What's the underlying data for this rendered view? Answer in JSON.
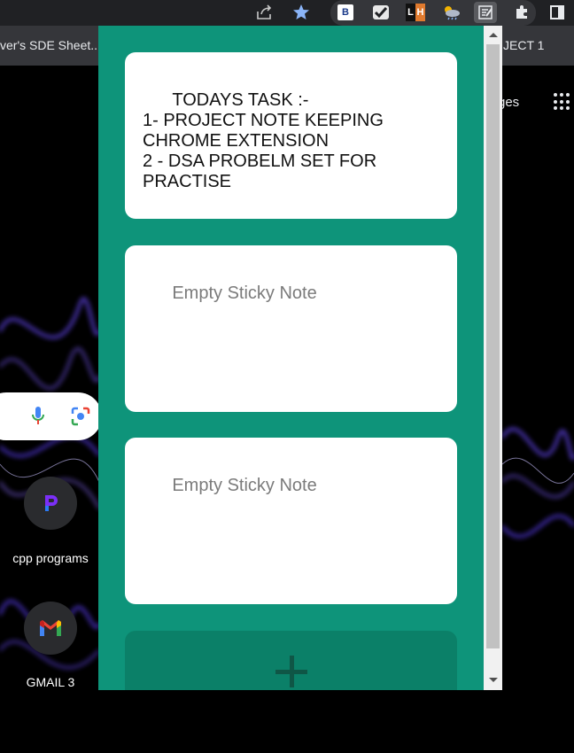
{
  "bookmarks": {
    "left": "ver's SDE Sheet..",
    "right": "JECT 1"
  },
  "ntp": {
    "pages_text": "ges",
    "shortcuts": [
      {
        "label": "cpp programs",
        "icon": "pcloud-icon"
      },
      {
        "label": "GMAIL 3",
        "icon": "gmail-icon"
      }
    ]
  },
  "notes": [
    {
      "text": "TODAYS TASK :-\n1- PROJECT NOTE KEEPING CHROME EXTENSION\n2 - DSA PROBELM SET FOR PRACTISE",
      "placeholder": ""
    },
    {
      "text": "",
      "placeholder": "Empty Sticky Note"
    },
    {
      "text": "",
      "placeholder": "Empty Sticky Note"
    }
  ],
  "extensions": {
    "b": "B",
    "lh_left": "L",
    "lh_right": "H"
  },
  "colors": {
    "popup_bg": "#0e947a",
    "add_button_bg": "#0b8068",
    "plus_color": "#0f5646"
  }
}
